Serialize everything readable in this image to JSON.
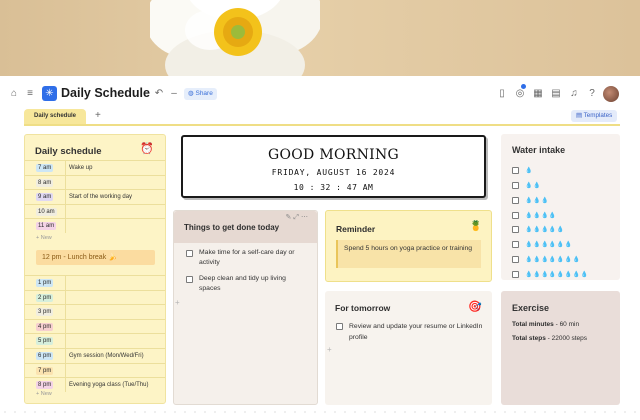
{
  "header": {
    "title": "Daily Schedule",
    "share_label": "Share",
    "notification_count": ""
  },
  "tabs": [
    {
      "label": "Daily schedule"
    }
  ],
  "templates_label": "Templates",
  "schedule": {
    "title": "Daily schedule",
    "new_label": "New",
    "rows_top": [
      {
        "time": "7 am",
        "task": "Wake up",
        "color": "#cde6f5"
      },
      {
        "time": "8 am",
        "task": "",
        "color": "#f0ede0"
      },
      {
        "time": "9 am",
        "task": "Start of the working day",
        "color": "#e0d8f2"
      },
      {
        "time": "10 am",
        "task": "",
        "color": "#f0ede0"
      },
      {
        "time": "11 am",
        "task": "",
        "color": "#f4d3e6"
      }
    ],
    "lunch_label": "12 pm - Lunch break",
    "rows_bottom": [
      {
        "time": "1 pm",
        "task": "",
        "color": "#cde6f5"
      },
      {
        "time": "2 pm",
        "task": "",
        "color": "#d6efdc"
      },
      {
        "time": "3 pm",
        "task": "",
        "color": "#f0ede0"
      },
      {
        "time": "4 pm",
        "task": "",
        "color": "#f6cfcf"
      },
      {
        "time": "5 pm",
        "task": "",
        "color": "#d6efdc"
      },
      {
        "time": "6 pm",
        "task": "Gym session (Mon/Wed/Fri)",
        "color": "#cde6f5"
      },
      {
        "time": "7 pm",
        "task": "",
        "color": "#fbe3b0"
      },
      {
        "time": "8 pm",
        "task": "Evening yoga class (Tue/Thu)",
        "color": "#f4d3e6"
      }
    ]
  },
  "greeting": {
    "line1": "GOOD MORNING",
    "line2": "FRIDAY, AUGUST 16 2024",
    "line3": "10 : 32 : 47 AM"
  },
  "water": {
    "title": "Water intake",
    "rows": [
      "💧",
      "💧💧",
      "💧💧💧",
      "💧💧💧💧",
      "💧💧💧💧💧",
      "💧💧💧💧💧💧",
      "💧💧💧💧💧💧💧",
      "💧💧💧💧💧💧💧💧"
    ]
  },
  "todo": {
    "title": "Things to get done today",
    "items": [
      "Make time for a self-care day or activity",
      "Deep clean and tidy up living spaces"
    ]
  },
  "reminder": {
    "title": "Reminder",
    "text": "Spend 5 hours on yoga practice or training"
  },
  "tomorrow": {
    "title": "For tomorrow",
    "items": [
      "Review and update your resume or LinkedIn profile"
    ]
  },
  "exercise": {
    "title": "Exercise",
    "minutes_label": "Total minutes",
    "minutes_value": "60 min",
    "steps_label": "Total steps",
    "steps_value": "22000 steps"
  },
  "colors": {
    "accent": "#2f6ee8",
    "tab": "#f7e79b"
  }
}
